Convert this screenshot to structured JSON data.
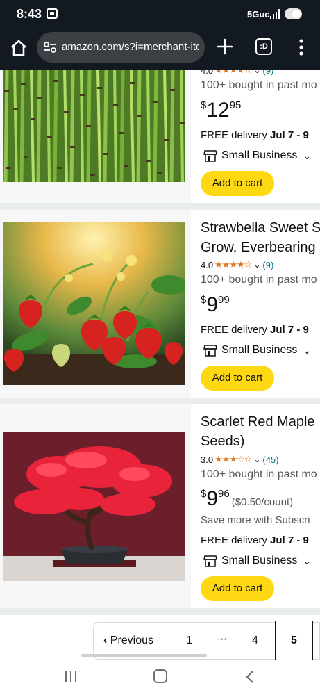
{
  "status_bar": {
    "time": "8:43",
    "network": "5Guc",
    "icons": [
      "screenshot-notification-icon",
      "signal-icon",
      "battery-toggle-icon"
    ]
  },
  "browser": {
    "url": "amazon.com/s?i=merchant-ite",
    "tabs_count": ":D",
    "icons": [
      "home-icon",
      "tune-icon",
      "plus-icon",
      "tabs-icon",
      "more-vert-icon"
    ]
  },
  "products": [
    {
      "rating": "4.0",
      "rating_count": "(9)",
      "bought": "100+ bought in past mo",
      "price_symbol": "$",
      "price_whole": "12",
      "price_fraction": "95",
      "delivery_prefix": "FREE delivery ",
      "delivery_dates": "Jul 7 - 9",
      "badge": "Small Business",
      "cart_label": "Add to cart",
      "image": "bamboo-image"
    },
    {
      "title_line1": "Strawbella Sweet S",
      "title_line2": "Grow, Everbearing",
      "rating": "4.0",
      "rating_count": "(9)",
      "bought": "100+ bought in past mo",
      "price_symbol": "$",
      "price_whole": "9",
      "price_fraction": "99",
      "delivery_prefix": "FREE delivery ",
      "delivery_dates": "Jul 7 - 9",
      "badge": "Small Business",
      "cart_label": "Add to cart",
      "image": "strawberry-plant-image"
    },
    {
      "title_line1": "Scarlet Red Maple",
      "title_line2": "Seeds)",
      "rating": "3.0",
      "rating_count": "(45)",
      "bought": "100+ bought in past mo",
      "price_symbol": "$",
      "price_whole": "9",
      "price_fraction": "96",
      "price_unit": "($0.50/count)",
      "save_more": "Save more with Subscri",
      "delivery_prefix": "FREE delivery ",
      "delivery_dates": "Jul 7 - 9",
      "badge": "Small Business",
      "cart_label": "Add to cart",
      "image": "red-maple-bonsai-image"
    }
  ],
  "pagination": {
    "previous_label": "Previous",
    "pages": [
      "1",
      "4"
    ],
    "ellipsis": "⋯",
    "current": "5"
  },
  "colors": {
    "header_bg": "#131921",
    "url_box_bg": "#3c3f44",
    "star": "#de7921",
    "link": "#007185",
    "cart_button": "#ffd814",
    "divider": "#eaeded"
  }
}
